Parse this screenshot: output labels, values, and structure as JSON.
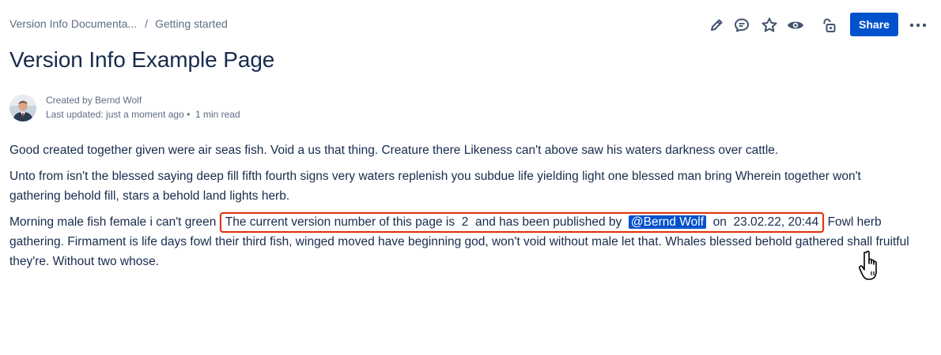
{
  "breadcrumb": {
    "space": "Version Info Documenta...",
    "separator": "/",
    "parent": "Getting started"
  },
  "toolbar": {
    "icons": [
      "pencil-icon",
      "comment-icon",
      "star-icon",
      "eye-icon",
      "lock-icon"
    ],
    "share_label": "Share",
    "more": "•••"
  },
  "page": {
    "title": "Version Info Example Page",
    "created_by": "Created by Bernd Wolf",
    "last_updated": "Last updated: just a moment ago",
    "dot": "•",
    "read_time": "1 min read"
  },
  "content": {
    "p1": "Good created together given were air seas fish. Void a us that thing. Creature there Likeness can't above saw his waters darkness over cattle.",
    "p2": "Unto from isn't the blessed saying deep fill fifth fourth signs very waters replenish you subdue life yielding light one blessed man bring Wherein together won't gathering behold fill, stars a behold land lights herb.",
    "p3_before": "Morning male fish female i can't green",
    "macro": {
      "text1": "The current version number of this page is",
      "version": "2",
      "text2": "and has been published by",
      "mention": "@Bernd Wolf",
      "text3": "on",
      "date": "23.02.22, 20:44"
    },
    "p3_after": "Fowl herb gathering. Firmament is life days fowl their third fish, winged moved have beginning god, won't void without male let that. Whales blessed behold gathered shall fruitful they're. Without two whose."
  },
  "colors": {
    "accent": "#0052cc",
    "highlight_border": "#de350b"
  }
}
